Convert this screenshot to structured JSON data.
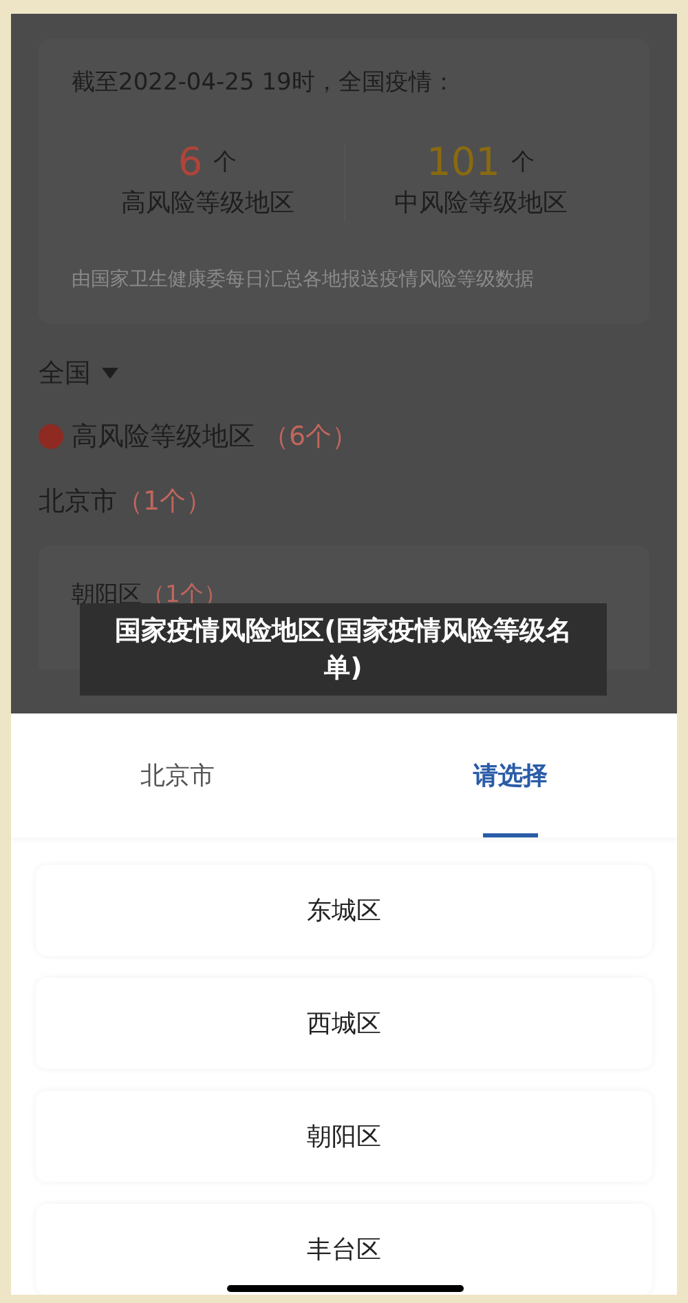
{
  "summary": {
    "title": "截至2022-04-25 19时，全国疫情：",
    "stats": [
      {
        "number": "6",
        "unit": "个",
        "label": "高风险等级地区",
        "color": "#b0443a"
      },
      {
        "number": "101",
        "unit": "个",
        "label": "中风险等级地区",
        "color": "#8a6a10"
      }
    ],
    "note": "由国家卫生健康委每日汇总各地报送疫情风险等级数据"
  },
  "region_filter": {
    "value": "全国"
  },
  "risk_heading": {
    "label": "高风险等级地区",
    "count": "（6个）",
    "color": "#8e2a22"
  },
  "city": {
    "name": "北京市",
    "count": "（1个）"
  },
  "district": {
    "name": "朝阳区",
    "count": "（1个）"
  },
  "caption": "国家疫情风险地区(国家疫情风险等级名单)",
  "picker": {
    "tabs": [
      {
        "label": "北京市",
        "selected": false
      },
      {
        "label": "请选择",
        "selected": true
      }
    ],
    "options": [
      {
        "label": "东城区"
      },
      {
        "label": "西城区"
      },
      {
        "label": "朝阳区"
      },
      {
        "label": "丰台区"
      }
    ]
  }
}
